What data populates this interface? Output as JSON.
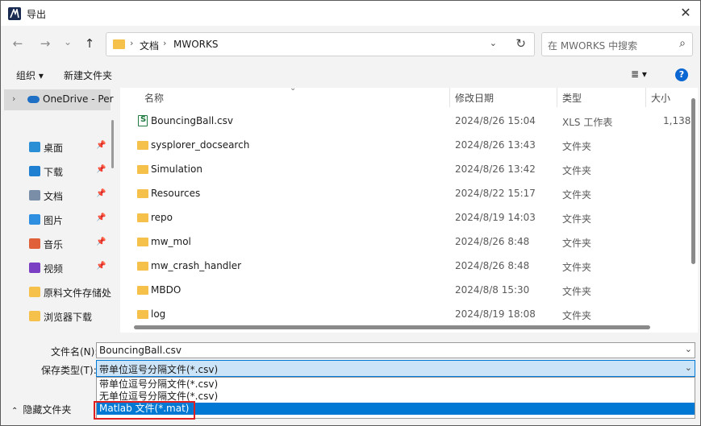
{
  "window": {
    "title": "导出",
    "close_icon": "✕"
  },
  "nav": {
    "back_icon": "←",
    "forward_icon": "→",
    "recent_icon": "⌄",
    "up_icon": "↑",
    "breadcrumb": [
      "文档",
      "MWORKS"
    ],
    "crumb_sep": "›",
    "dropdown_icon": "⌄",
    "refresh_icon": "↻",
    "search_placeholder": "在 MWORKS 中搜索",
    "search_icon": "⌕"
  },
  "toolbar": {
    "organize": "组织 ▾",
    "new_folder": "新建文件夹",
    "view_icon": "≣ ▾",
    "help_icon": "?"
  },
  "sidebar": {
    "onedrive": {
      "chevron": "›",
      "label": "OneDrive - Per"
    },
    "items": [
      {
        "label": "桌面",
        "color": "#2b8fd6",
        "pinned": true
      },
      {
        "label": "下载",
        "color": "#1f7fd0",
        "pinned": true
      },
      {
        "label": "文档",
        "color": "#7a8ea8",
        "pinned": true
      },
      {
        "label": "图片",
        "color": "#2e8ee0",
        "pinned": true
      },
      {
        "label": "音乐",
        "color": "#e0603a",
        "pinned": true
      },
      {
        "label": "视频",
        "color": "#7b3fc4",
        "pinned": true
      },
      {
        "label": "原料文件存储处",
        "color": "#f5c14a",
        "pinned": false
      },
      {
        "label": "浏览器下载",
        "color": "#f5c14a",
        "pinned": false
      }
    ],
    "pin_icon": "📌"
  },
  "columns": {
    "name": "名称",
    "date": "修改日期",
    "type": "类型",
    "size": "大小",
    "sort_icon": "⌄"
  },
  "files": [
    {
      "name": "BouncingBall.csv",
      "date": "2024/8/26 15:04",
      "type": "XLS 工作表",
      "size": "1,138",
      "kind": "csv"
    },
    {
      "name": "sysplorer_docsearch",
      "date": "2024/8/26 13:43",
      "type": "文件夹",
      "size": "",
      "kind": "folder"
    },
    {
      "name": "Simulation",
      "date": "2024/8/26 13:42",
      "type": "文件夹",
      "size": "",
      "kind": "folder"
    },
    {
      "name": "Resources",
      "date": "2024/8/22 15:17",
      "type": "文件夹",
      "size": "",
      "kind": "folder"
    },
    {
      "name": "repo",
      "date": "2024/8/19 14:03",
      "type": "文件夹",
      "size": "",
      "kind": "folder"
    },
    {
      "name": "mw_mol",
      "date": "2024/8/26 8:48",
      "type": "文件夹",
      "size": "",
      "kind": "folder"
    },
    {
      "name": "mw_crash_handler",
      "date": "2024/8/26 8:48",
      "type": "文件夹",
      "size": "",
      "kind": "folder"
    },
    {
      "name": "MBDO",
      "date": "2024/8/8 15:30",
      "type": "文件夹",
      "size": "",
      "kind": "folder"
    },
    {
      "name": "log",
      "date": "2024/8/19 18:08",
      "type": "文件夹",
      "size": "",
      "kind": "folder"
    }
  ],
  "form": {
    "filename_label": "文件名(N):",
    "filename_value": "BouncingBall.csv",
    "filetype_label": "保存类型(T):",
    "filetype_value": "带单位逗号分隔文件(*.csv)",
    "dropdown_icon": "⌄",
    "options": [
      {
        "label": "带单位逗号分隔文件(*.csv)",
        "selected": false
      },
      {
        "label": "无单位逗号分隔文件(*.csv)",
        "selected": false
      },
      {
        "label": "Matlab 文件(*.mat)",
        "selected": true
      }
    ],
    "hide_folders_chevron": "⌃",
    "hide_folders": "隐藏文件夹"
  }
}
